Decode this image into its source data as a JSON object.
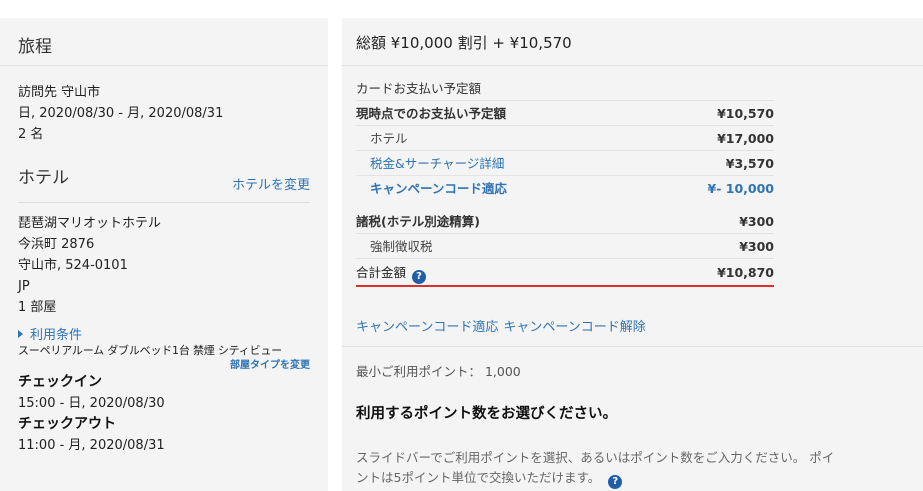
{
  "itinerary": {
    "title": "旅程",
    "destination": "訪問先 守山市",
    "dates": "日, 2020/08/30 - 月, 2020/08/31",
    "guests": "2 名"
  },
  "hotel": {
    "title": "ホテル",
    "change_link": "ホテルを変更",
    "name": "琵琶湖マリオットホテル",
    "address1": "今浜町 2876",
    "address2": "守山市, 524-0101",
    "country": "JP",
    "rooms": "1 部屋",
    "terms_link": "利用条件",
    "room_type": "スーペリアルーム ダブルベッド1台 禁煙 シティビュー",
    "room_change_link": "部屋タイプを変更",
    "checkin_label": "チェックイン",
    "checkin_value": "15:00 - 日, 2020/08/30",
    "checkout_label": "チェックアウト",
    "checkout_value": "11:00 - 月, 2020/08/31"
  },
  "summary": {
    "header": "総額 ¥10,000 割引 + ¥10,570",
    "card_section": "カードお支払い予定額",
    "now_label": "現時点でのお支払い予定額",
    "now_value": "¥10,570",
    "hotel_label": "ホテル",
    "hotel_value": "¥17,000",
    "tax_detail_label": "税金&サーチャージ詳細",
    "tax_detail_value": "¥3,570",
    "campaign_label": "キャンペーンコード適応",
    "campaign_value": "¥- 10,000",
    "other_tax_label": "諸税(ホテル別途精算)",
    "other_tax_value": "¥300",
    "mandatory_tax_label": "強制徴収税",
    "mandatory_tax_value": "¥300",
    "total_label": "合計金額",
    "total_value": "¥10,870",
    "help_glyph": "?"
  },
  "campaign": {
    "apply_link": "キャンペーンコード適応",
    "remove_link": "キャンペーンコード解除"
  },
  "points": {
    "min_points": "最小ご利用ポイント： 1,000",
    "choose_title": "利用するポイント数をお選びください。",
    "description": "スライドバーでご利用ポイントを選択、あるいはポイント数をご入力ください。 ポイントは5ポイント単位で交換いただけます。"
  },
  "colors": {
    "link": "#2f73b4",
    "total_underline": "#d9302c",
    "panel_bg": "#f4f4f4"
  }
}
